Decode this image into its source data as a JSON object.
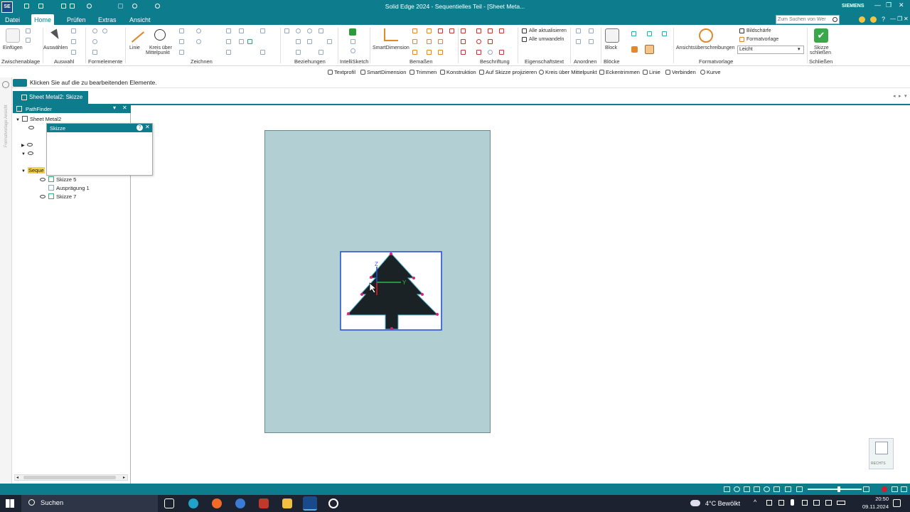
{
  "title_bar": {
    "app_logo": "SE",
    "title": "Solid Edge 2024 - Sequentielles Teil - [Sheet Meta...",
    "brand": "SIEMENS",
    "search_placeholder": "Zum Suchen von Wer"
  },
  "menu": {
    "items": [
      "Datei",
      "Home",
      "Prüfen",
      "Extras",
      "Ansicht"
    ],
    "active": "Home"
  },
  "ribbon": {
    "buttons": {
      "paste": "Einfügen",
      "select": "Auswählen",
      "line": "Linie",
      "circle_a": "Kreis über",
      "circle_b": "Mittelpunkt",
      "smart_dimension": "SmartDimension",
      "update_all": "Alle aktualisieren",
      "convert_all": "Alle umwandeln",
      "block": "Block",
      "annotations": "Ansichtsüberschreibungen",
      "sharpness": "Bildschärfe",
      "format_template": "Formatvorlage",
      "close_a": "Skizze",
      "close_b": "schließen"
    },
    "groups": {
      "clipboard": "Zwischenablage",
      "selection": "Auswahl",
      "form_elements": "Formelemente",
      "draw": "Zeichnen",
      "relations": "Beziehungen",
      "intellisketch": "IntelliSketch",
      "dimension": "Bemaßen",
      "annotation": "Beschriftung",
      "properties_text": "Eigenschaftstext",
      "arrange": "Anordnen",
      "blocks": "Blöcke",
      "style": "Formatvorlage",
      "close": "Schließen"
    },
    "style_select_value": "Leicht"
  },
  "command_bar": {
    "items": [
      "Textprofil",
      "SmartDimension",
      "Trimmen",
      "Konstruktion",
      "Auf Skizze projizieren",
      "Kreis über Mittelpunkt",
      "Eckentrimmen",
      "Linie",
      "Verbinden",
      "Kurve"
    ]
  },
  "prompt_text": "Klicken Sie auf die zu bearbeitenden Elemente.",
  "document_tab": "Sheet Metal2: Skizze",
  "side_vertical_text": "Formatvorlage Ansicht",
  "pathfinder": {
    "title": "PathFinder",
    "root": "Sheet Metal2",
    "popup_title": "Skizze",
    "popup_help": "?",
    "items": [
      {
        "label": "Seque"
      },
      {
        "label": "Skizze 5"
      },
      {
        "label": "Ausprägung 1"
      },
      {
        "label": "Skizze 7"
      }
    ]
  },
  "canvas": {
    "axis_z": "Z",
    "axis_y": "Y",
    "sheet_color": "#b2d0d4",
    "tree_color": "#1b2226"
  },
  "view_cube_label": "RECHTS",
  "taskbar": {
    "search_label": "Suchen",
    "weather": "4°C Bewölkt",
    "time": "20:50",
    "date": "09.11.2024"
  },
  "colors": {
    "accent": "#0d7d8e",
    "taskbar": "#1c2230",
    "handle": "#e0217a",
    "axis_x": "#e02020",
    "axis_y": "#22c040",
    "axis_z": "#2050e0"
  }
}
